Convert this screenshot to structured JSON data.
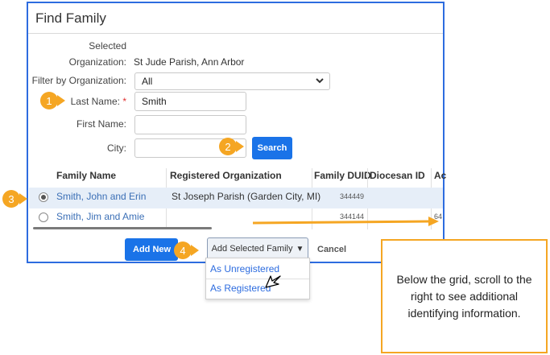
{
  "dialog": {
    "title": "Find Family"
  },
  "form": {
    "selected_org_label_1": "Selected",
    "selected_org_label_2": "Organization:",
    "selected_org_value": "St Jude Parish, Ann Arbor",
    "filter_label": "Filter by Organization:",
    "filter_value": "All",
    "last_name_label": "Last Name:",
    "required_mark": "*",
    "last_name_value": "Smith",
    "first_name_label": "First Name:",
    "first_name_value": "",
    "city_label": "City:",
    "city_value": "",
    "search_label": "Search"
  },
  "grid": {
    "columns": [
      "Family Name",
      "Registered Organization",
      "Family DUID",
      "Diocesan ID",
      "Ac"
    ],
    "rows": [
      {
        "family_name": "Smith, John and Erin",
        "registered_org": "St Joseph Parish (Garden City, MI)",
        "duid": "344449",
        "selected": true
      },
      {
        "family_name": "Smith, Jim and Amie",
        "registered_org": "",
        "duid": "344144",
        "extra": "64",
        "selected": false
      }
    ]
  },
  "footer": {
    "add_new_label": "Add New",
    "add_selected_label": "Add Selected Family",
    "cancel_label": "Cancel"
  },
  "dropdown": {
    "items": [
      "As Unregistered",
      "As Registered"
    ]
  },
  "steps": [
    "1",
    "2",
    "3",
    "4"
  ],
  "callout": {
    "text": "Below the grid, scroll to the right to see additional identifying information."
  },
  "colors": {
    "accent": "#1a73e8",
    "callout_orange": "#f5a623",
    "link": "#3b6fb6",
    "selected_row": "#e6eef8"
  }
}
